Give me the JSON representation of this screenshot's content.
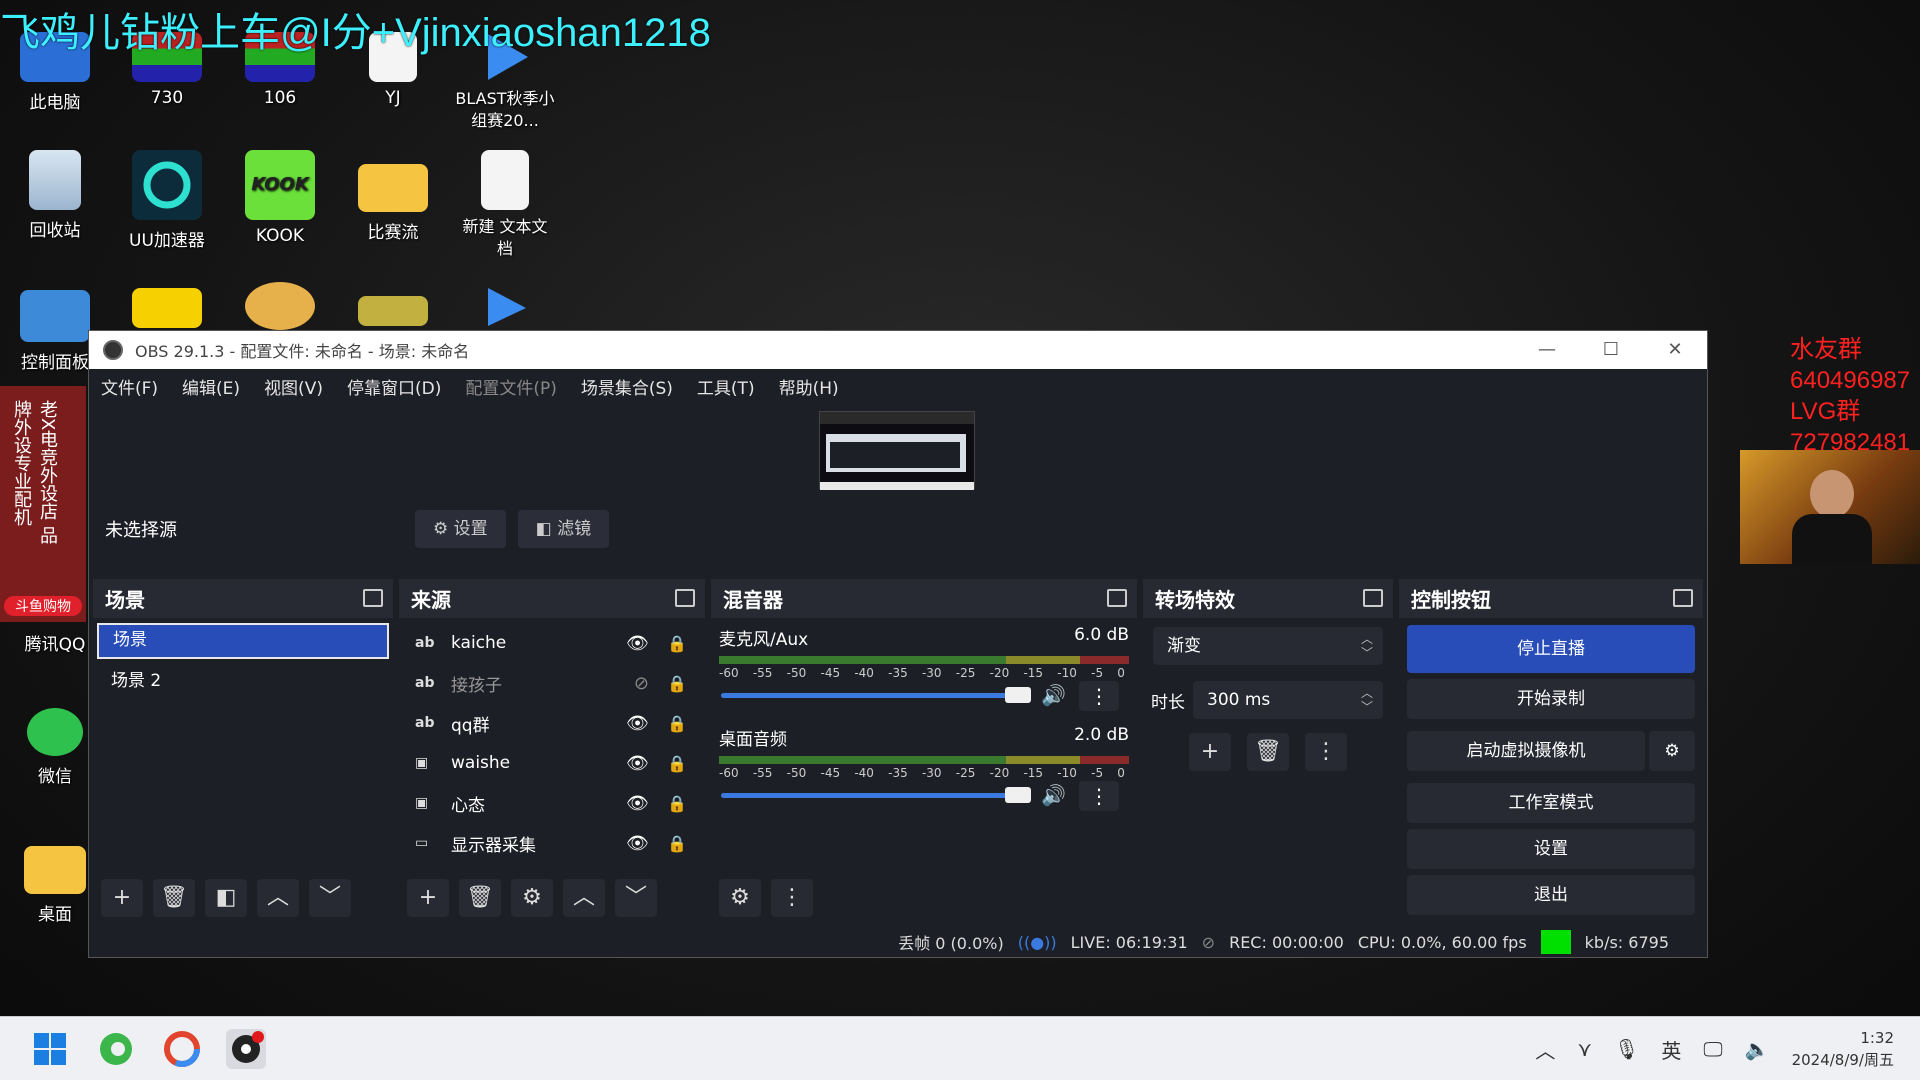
{
  "overlay": {
    "banner": "飞鸡儿钻粉上车@I分+Vjinxiaoshan1218",
    "qq_lines": [
      "水友群",
      "640496987",
      "LVG群",
      "727982481"
    ],
    "left_ad": "老X电竞外设店 品牌外设专业配机",
    "left_ad_bottom": "斗鱼购物"
  },
  "desktop": {
    "icons": [
      {
        "label": "此电脑"
      },
      {
        "label": "730"
      },
      {
        "label": "106"
      },
      {
        "label": "YJ"
      },
      {
        "label": "BLAST秋季小组赛20..."
      },
      {
        "label": "回收站"
      },
      {
        "label": "UU加速器"
      },
      {
        "label": "KOOK"
      },
      {
        "label": "比赛流"
      },
      {
        "label": "新建 文本文档"
      },
      {
        "label": "控制面板"
      },
      {
        "label": "腾讯QQ"
      },
      {
        "label": "微信"
      },
      {
        "label": "桌面"
      }
    ]
  },
  "obs": {
    "title": "OBS 29.1.3 - 配置文件: 未命名 - 场景: 未命名",
    "menu": [
      "文件(F)",
      "编辑(E)",
      "视图(V)",
      "停靠窗口(D)",
      "配置文件(P)",
      "场景集合(S)",
      "工具(T)",
      "帮助(H)"
    ],
    "no_source": "未选择源",
    "settings_btn": "设置",
    "filters_btn": "滤镜",
    "docks": {
      "scenes": {
        "title": "场景",
        "items": [
          "场景",
          "场景 2"
        ]
      },
      "sources": {
        "title": "来源",
        "items": [
          {
            "type": "ab",
            "name": "kaiche"
          },
          {
            "type": "ab",
            "name": "接孩子"
          },
          {
            "type": "ab",
            "name": "qq群"
          },
          {
            "type": "img",
            "name": "waishe"
          },
          {
            "type": "img",
            "name": "心态"
          },
          {
            "type": "mon",
            "name": "显示器采集"
          }
        ]
      },
      "mixer": {
        "title": "混音器",
        "channels": [
          {
            "name": "麦克风/Aux",
            "db": "6.0 dB"
          },
          {
            "name": "桌面音频",
            "db": "2.0 dB"
          }
        ],
        "scale": [
          "-60",
          "-55",
          "-50",
          "-45",
          "-40",
          "-35",
          "-30",
          "-25",
          "-20",
          "-15",
          "-10",
          "-5",
          "0"
        ]
      },
      "transitions": {
        "title": "转场特效",
        "selected": "渐变",
        "duration_label": "时长",
        "duration": "300 ms"
      },
      "controls": {
        "title": "控制按钮",
        "buttons": [
          "停止直播",
          "开始录制",
          "启动虚拟摄像机",
          "工作室模式",
          "设置",
          "退出"
        ]
      }
    },
    "status": {
      "dropped": "丢帧 0 (0.0%)",
      "live": "LIVE: 06:19:31",
      "rec": "REC: 00:00:00",
      "cpu": "CPU: 0.0%, 60.00 fps",
      "kbps": "kb/s: 6795"
    }
  },
  "taskbar": {
    "ime": "英",
    "time": "1:32",
    "date": "2024/8/9/周五"
  }
}
